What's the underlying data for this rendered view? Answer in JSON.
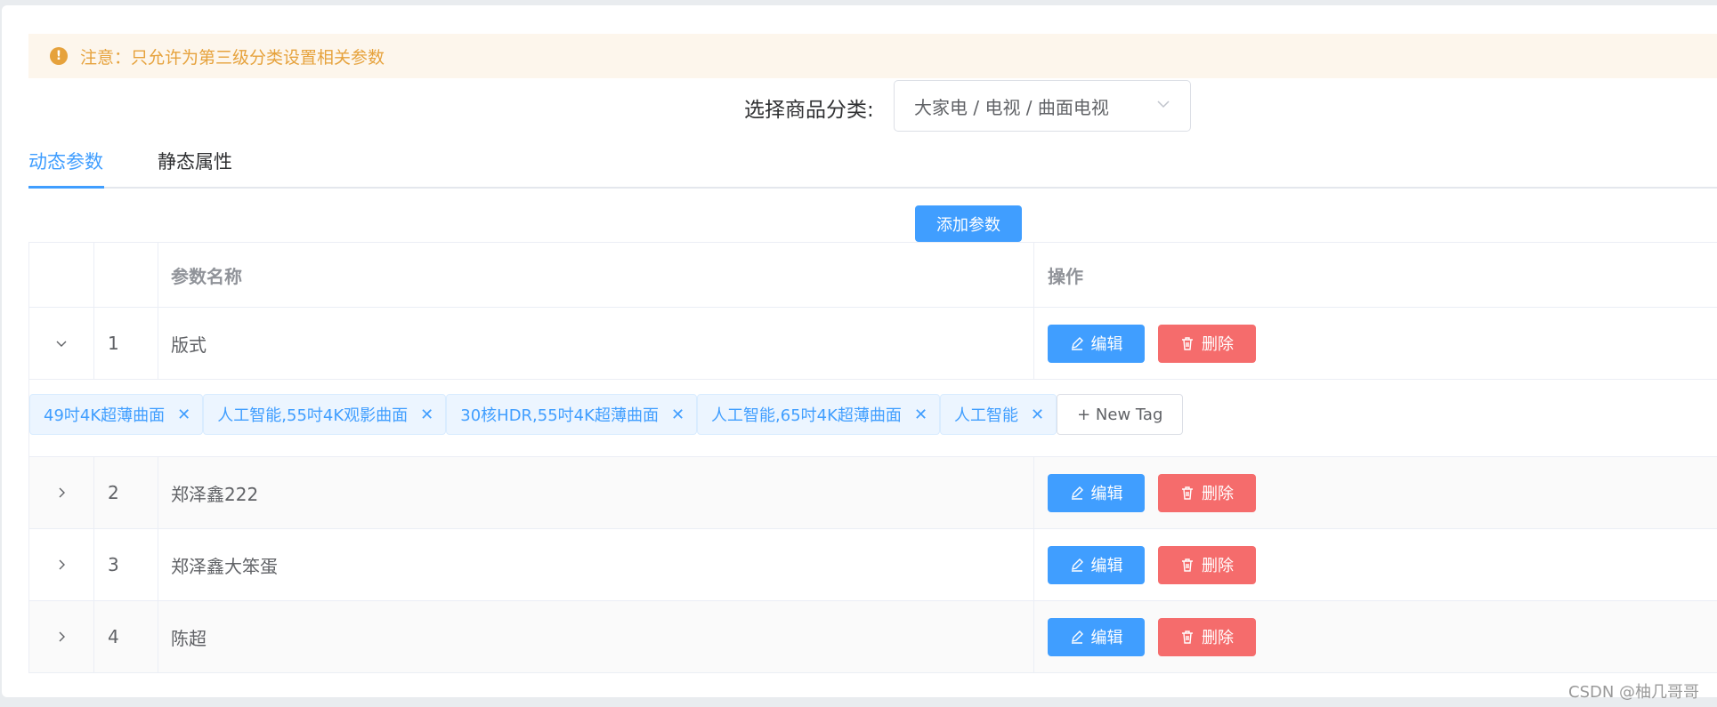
{
  "alert": {
    "text": "注意：只允许为第三级分类设置相关参数",
    "icon": "warning-circle-icon"
  },
  "category": {
    "label": "选择商品分类:",
    "value": "大家电 / 电视 / 曲面电视"
  },
  "tabs": [
    {
      "label": "动态参数",
      "active": true
    },
    {
      "label": "静态属性",
      "active": false
    }
  ],
  "add_button": "添加参数",
  "table": {
    "headers": [
      "",
      "",
      "参数名称",
      "操作"
    ],
    "rows": [
      {
        "index": "1",
        "name": "版式",
        "expanded": true
      },
      {
        "index": "2",
        "name": "郑泽鑫222",
        "expanded": false
      },
      {
        "index": "3",
        "name": "郑泽鑫大笨蛋",
        "expanded": false
      },
      {
        "index": "4",
        "name": "陈超",
        "expanded": false
      }
    ],
    "edit_label": "编辑",
    "delete_label": "删除"
  },
  "tags": [
    "49吋4K超薄曲面",
    "人工智能,55吋4K观影曲面",
    "30核HDR,55吋4K超薄曲面",
    "人工智能,65吋4K超薄曲面",
    "人工智能"
  ],
  "new_tag_label": "+ New Tag",
  "watermark": "CSDN @柚几哥哥",
  "colors": {
    "primary": "#409eff",
    "danger": "#f56c6c",
    "warning": "#e6a23c"
  }
}
